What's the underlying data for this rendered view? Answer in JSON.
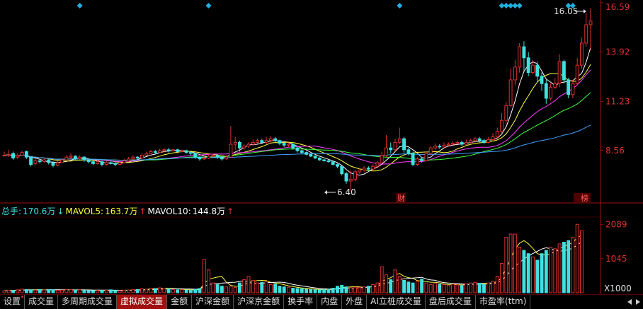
{
  "price_axis": {
    "labels": [
      "16.59",
      "13.92",
      "11.23",
      "8.56"
    ],
    "values": [
      16.59,
      13.92,
      11.23,
      8.56
    ]
  },
  "volume_axis": {
    "labels": [
      "2089",
      "1045",
      "X1000"
    ],
    "values": [
      2089,
      1045
    ]
  },
  "annotations": {
    "high": "16.05",
    "low": "6.40",
    "markers": [
      "财",
      "榜"
    ]
  },
  "volume_header": {
    "total_label": "总手:",
    "total_value": "170.6万",
    "ma5_label": "MAVOL5:",
    "ma5_value": "163.7万",
    "ma10_label": "MAVOL10:",
    "ma10_value": "144.8万"
  },
  "tabs": [
    {
      "label": "设置",
      "active": false,
      "dot": true
    },
    {
      "label": "成交量",
      "active": false
    },
    {
      "label": "多周期成交量",
      "active": false
    },
    {
      "label": "虚拟成交量",
      "active": true
    },
    {
      "label": "金额",
      "active": false
    },
    {
      "label": "沪深金额",
      "active": false
    },
    {
      "label": "沪深京金额",
      "active": false
    },
    {
      "label": "换手率",
      "active": false
    },
    {
      "label": "内盘",
      "active": false
    },
    {
      "label": "外盘",
      "active": false
    },
    {
      "label": "AI立桩成交量",
      "active": false
    },
    {
      "label": "盘后成交量",
      "active": false
    },
    {
      "label": "市盈率(ttm)",
      "active": false
    }
  ],
  "colors": {
    "up": "#e03030",
    "down": "#40e0e0",
    "ma5": "#ffffff",
    "ma10": "#ffff40",
    "ma20": "#ff40ff",
    "ma30": "#40ff40",
    "ma60": "#40a0ff"
  },
  "chart_data": {
    "type": "candlestick",
    "ylim": [
      5.9,
      16.59
    ],
    "ohlc": [
      [
        8.3,
        8.3,
        8.5,
        8.25
      ],
      [
        8.35,
        8.35,
        8.6,
        8.2
      ],
      [
        8.4,
        8.15,
        8.5,
        8.05
      ],
      [
        8.2,
        8.3,
        8.4,
        8.1
      ],
      [
        8.3,
        8.45,
        8.55,
        8.25
      ],
      [
        8.5,
        8.2,
        8.55,
        8.1
      ],
      [
        8.2,
        7.8,
        8.25,
        7.7
      ],
      [
        7.85,
        8.0,
        8.1,
        7.75
      ],
      [
        8.0,
        7.95,
        8.1,
        7.85
      ],
      [
        7.95,
        8.05,
        8.15,
        7.9
      ],
      [
        8.05,
        7.9,
        8.1,
        7.8
      ],
      [
        7.9,
        7.75,
        7.95,
        7.65
      ],
      [
        7.75,
        7.9,
        8.0,
        7.7
      ],
      [
        7.9,
        8.05,
        8.15,
        7.85
      ],
      [
        8.05,
        8.2,
        8.3,
        8.0
      ],
      [
        8.2,
        8.25,
        8.4,
        8.1
      ],
      [
        8.25,
        8.1,
        8.3,
        8.0
      ],
      [
        8.1,
        8.2,
        8.3,
        8.05
      ],
      [
        8.2,
        8.05,
        8.25,
        7.95
      ],
      [
        8.05,
        7.95,
        8.1,
        7.85
      ],
      [
        7.95,
        7.85,
        8.0,
        7.75
      ],
      [
        7.85,
        7.95,
        8.05,
        7.8
      ],
      [
        7.95,
        7.8,
        8.0,
        7.7
      ],
      [
        7.8,
        7.9,
        8.0,
        7.75
      ],
      [
        7.9,
        7.85,
        7.95,
        7.8
      ],
      [
        7.85,
        7.8,
        7.9,
        7.7
      ],
      [
        7.8,
        7.9,
        8.0,
        7.75
      ],
      [
        7.9,
        8.0,
        8.1,
        7.85
      ],
      [
        8.0,
        8.1,
        8.2,
        7.95
      ],
      [
        8.1,
        8.2,
        8.3,
        8.05
      ],
      [
        8.2,
        8.15,
        8.25,
        8.05
      ],
      [
        8.15,
        8.3,
        8.4,
        8.1
      ],
      [
        8.3,
        8.4,
        8.5,
        8.25
      ],
      [
        8.4,
        8.5,
        8.6,
        8.35
      ],
      [
        8.5,
        8.45,
        8.6,
        8.35
      ],
      [
        8.45,
        8.55,
        8.65,
        8.4
      ],
      [
        8.55,
        8.6,
        8.7,
        8.45
      ],
      [
        8.6,
        8.55,
        8.7,
        8.45
      ],
      [
        8.55,
        8.6,
        8.65,
        8.5
      ],
      [
        8.6,
        8.5,
        8.65,
        8.4
      ],
      [
        8.5,
        8.55,
        8.6,
        8.45
      ],
      [
        8.55,
        8.45,
        8.6,
        8.4
      ],
      [
        8.45,
        8.4,
        8.5,
        8.3
      ],
      [
        8.4,
        8.2,
        8.45,
        8.1
      ],
      [
        8.2,
        8.1,
        8.25,
        8.0
      ],
      [
        8.1,
        8.15,
        8.25,
        8.05
      ],
      [
        8.15,
        8.25,
        8.35,
        8.1
      ],
      [
        8.25,
        8.3,
        8.4,
        8.2
      ],
      [
        8.3,
        8.2,
        8.35,
        8.1
      ],
      [
        8.2,
        8.1,
        8.25,
        8.0
      ],
      [
        8.1,
        8.2,
        8.3,
        8.05
      ],
      [
        8.2,
        8.9,
        9.9,
        8.15
      ],
      [
        8.9,
        9.0,
        9.3,
        8.6
      ],
      [
        9.0,
        8.7,
        9.1,
        8.5
      ],
      [
        8.7,
        8.8,
        8.9,
        8.6
      ],
      [
        8.8,
        8.9,
        9.0,
        8.7
      ],
      [
        8.9,
        9.0,
        9.15,
        8.8
      ],
      [
        9.0,
        9.1,
        9.2,
        8.9
      ],
      [
        9.1,
        9.0,
        9.2,
        8.9
      ],
      [
        9.0,
        9.1,
        9.3,
        8.9
      ],
      [
        9.1,
        9.2,
        9.35,
        9.0
      ],
      [
        9.2,
        9.1,
        9.3,
        9.0
      ],
      [
        9.1,
        8.95,
        9.15,
        8.85
      ],
      [
        8.95,
        8.85,
        9.0,
        8.75
      ],
      [
        8.85,
        8.9,
        9.0,
        8.75
      ],
      [
        8.9,
        8.7,
        8.95,
        8.6
      ],
      [
        8.7,
        8.55,
        8.75,
        8.45
      ],
      [
        8.55,
        8.45,
        8.6,
        8.35
      ],
      [
        8.45,
        8.35,
        8.5,
        8.3
      ],
      [
        8.35,
        8.25,
        8.4,
        8.2
      ],
      [
        8.25,
        8.15,
        8.3,
        8.1
      ],
      [
        8.15,
        8.05,
        8.2,
        8.0
      ],
      [
        8.05,
        8.0,
        8.1,
        7.95
      ],
      [
        8.0,
        7.95,
        8.05,
        7.9
      ],
      [
        7.95,
        7.8,
        8.0,
        7.75
      ],
      [
        7.8,
        7.7,
        7.85,
        7.6
      ],
      [
        7.7,
        7.3,
        7.75,
        7.2
      ],
      [
        7.3,
        6.9,
        7.4,
        6.75
      ],
      [
        6.9,
        7.0,
        7.5,
        6.4
      ],
      [
        7.0,
        7.4,
        7.5,
        6.9
      ],
      [
        7.4,
        7.5,
        7.6,
        7.3
      ],
      [
        7.5,
        7.6,
        7.7,
        7.4
      ],
      [
        7.6,
        7.55,
        7.7,
        7.45
      ],
      [
        7.55,
        7.7,
        7.8,
        7.5
      ],
      [
        7.7,
        7.9,
        8.0,
        7.65
      ],
      [
        7.9,
        8.3,
        8.5,
        7.85
      ],
      [
        8.3,
        8.7,
        9.4,
        8.2
      ],
      [
        8.7,
        8.6,
        9.0,
        8.4
      ],
      [
        8.6,
        9.0,
        9.2,
        8.5
      ],
      [
        9.0,
        9.2,
        9.8,
        8.9
      ],
      [
        9.2,
        8.6,
        9.3,
        8.4
      ],
      [
        8.6,
        8.4,
        8.7,
        8.3
      ],
      [
        8.4,
        7.8,
        8.5,
        7.7
      ],
      [
        7.8,
        8.1,
        8.2,
        7.7
      ],
      [
        8.1,
        8.0,
        8.2,
        7.9
      ],
      [
        8.0,
        8.4,
        8.5,
        7.95
      ],
      [
        8.4,
        8.7,
        8.8,
        8.3
      ],
      [
        8.7,
        8.8,
        8.95,
        8.6
      ],
      [
        8.8,
        8.75,
        8.9,
        8.65
      ],
      [
        8.75,
        8.85,
        9.0,
        8.7
      ],
      [
        8.85,
        8.9,
        9.0,
        8.8
      ],
      [
        8.9,
        8.95,
        9.05,
        8.8
      ],
      [
        8.95,
        9.0,
        9.1,
        8.9
      ],
      [
        9.0,
        8.9,
        9.1,
        8.8
      ],
      [
        8.9,
        9.0,
        9.15,
        8.85
      ],
      [
        9.0,
        9.1,
        9.2,
        8.95
      ],
      [
        9.1,
        9.2,
        9.3,
        9.0
      ],
      [
        9.2,
        9.1,
        9.3,
        9.0
      ],
      [
        9.1,
        9.0,
        9.2,
        8.9
      ],
      [
        9.0,
        9.15,
        9.3,
        8.95
      ],
      [
        9.15,
        9.3,
        9.5,
        9.1
      ],
      [
        9.3,
        9.6,
        9.8,
        9.2
      ],
      [
        9.6,
        10.2,
        10.6,
        9.5
      ],
      [
        10.2,
        11.0,
        11.2,
        10.0
      ],
      [
        11.0,
        12.4,
        13.0,
        10.9
      ],
      [
        12.4,
        13.1,
        13.5,
        12.1
      ],
      [
        13.1,
        14.2,
        14.4,
        12.8
      ],
      [
        14.2,
        13.6,
        14.5,
        12.9
      ],
      [
        13.6,
        12.8,
        13.9,
        12.6
      ],
      [
        12.8,
        13.2,
        13.5,
        12.7
      ],
      [
        13.2,
        12.6,
        13.4,
        12.3
      ],
      [
        12.6,
        12.2,
        12.8,
        11.8
      ],
      [
        12.2,
        11.4,
        12.4,
        11.1
      ],
      [
        11.4,
        12.0,
        12.2,
        11.3
      ],
      [
        12.0,
        12.2,
        12.5,
        11.9
      ],
      [
        12.2,
        13.4,
        13.8,
        12.0
      ],
      [
        13.4,
        12.4,
        13.5,
        12.2
      ],
      [
        12.4,
        11.6,
        12.5,
        11.4
      ],
      [
        11.6,
        12.2,
        12.4,
        11.4
      ],
      [
        12.2,
        13.2,
        13.6,
        12.1
      ],
      [
        13.2,
        14.4,
        14.7,
        13.0
      ],
      [
        14.4,
        15.4,
        16.05,
        14.2
      ],
      [
        15.4,
        15.6,
        16.3,
        14.0
      ]
    ],
    "volume": [
      60,
      80,
      70,
      90,
      110,
      100,
      90,
      80,
      95,
      85,
      100,
      90,
      75,
      80,
      95,
      100,
      85,
      90,
      80,
      70,
      65,
      70,
      75,
      80,
      90,
      70,
      65,
      80,
      85,
      95,
      100,
      120,
      110,
      140,
      130,
      150,
      140,
      120,
      100,
      90,
      95,
      85,
      80,
      100,
      130,
      1020,
      700,
      300,
      250,
      200,
      180,
      200,
      160,
      300,
      400,
      500,
      380,
      300,
      320,
      350,
      250,
      260,
      200,
      180,
      170,
      140,
      130,
      120,
      110,
      100,
      90,
      85,
      95,
      110,
      140,
      200,
      230,
      180,
      150,
      170,
      160,
      180,
      200,
      250,
      300,
      800,
      550,
      400,
      700,
      500,
      380,
      330,
      300,
      350,
      420,
      300,
      250,
      280,
      260,
      250,
      230,
      260,
      240,
      220,
      280,
      300,
      320,
      290,
      260,
      300,
      350,
      500,
      900,
      1700,
      1800,
      1800,
      1400,
      1300,
      1200,
      1100,
      1000,
      1200,
      1300,
      1400,
      1350,
      1500,
      1550,
      1600,
      1700,
      2100,
      1900
    ],
    "volume_ylim": [
      0,
      2300
    ],
    "volume_unit": "X1000",
    "high": 16.05,
    "low": 6.4
  }
}
